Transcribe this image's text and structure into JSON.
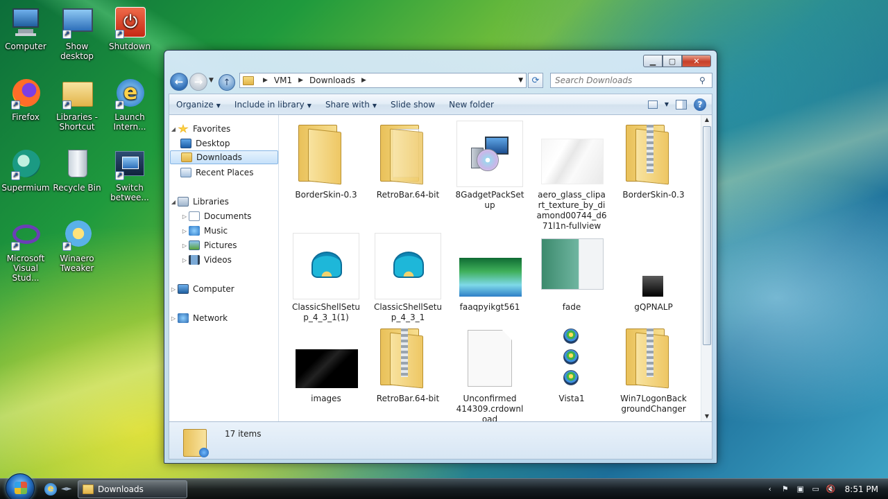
{
  "desktop": {
    "icons": [
      {
        "label": "Computer"
      },
      {
        "label": "Show desktop"
      },
      {
        "label": "Shutdown"
      },
      {
        "label": "Firefox"
      },
      {
        "label": "Libraries - Shortcut"
      },
      {
        "label": "Launch Intern..."
      },
      {
        "label": "Supermium"
      },
      {
        "label": "Recycle Bin"
      },
      {
        "label": "Switch betwee..."
      },
      {
        "label": "Microsoft Visual Stud..."
      },
      {
        "label": "Winaero Tweaker"
      }
    ]
  },
  "window": {
    "address": {
      "crumbs": [
        "VM1",
        "Downloads"
      ]
    },
    "search": {
      "placeholder": "Search Downloads"
    },
    "toolbar": {
      "organize": "Organize",
      "include": "Include in library",
      "share": "Share with",
      "slideshow": "Slide show",
      "newfolder": "New folder"
    },
    "nav": {
      "favorites": "Favorites",
      "desktop": "Desktop",
      "downloads": "Downloads",
      "recent": "Recent Places",
      "libraries": "Libraries",
      "documents": "Documents",
      "music": "Music",
      "pictures": "Pictures",
      "videos": "Videos",
      "computer": "Computer",
      "network": "Network"
    },
    "files": [
      {
        "name": "BorderSkin-0.3"
      },
      {
        "name": "RetroBar.64-bit"
      },
      {
        "name": "8GadgetPackSetup"
      },
      {
        "name": "aero_glass_clipart_texture_by_diamond00744_d671l1n-fullview"
      },
      {
        "name": "BorderSkin-0.3"
      },
      {
        "name": "ClassicShellSetup_4_3_1(1)"
      },
      {
        "name": "ClassicShellSetup_4_3_1"
      },
      {
        "name": "faaqpyikgt561"
      },
      {
        "name": "fade"
      },
      {
        "name": "gQPNALP"
      },
      {
        "name": "images"
      },
      {
        "name": "RetroBar.64-bit"
      },
      {
        "name": "Unconfirmed 414309.crdownload"
      },
      {
        "name": "Vista1"
      },
      {
        "name": "Win7LogonBackgroundChanger"
      }
    ],
    "details": {
      "count": "17 items"
    }
  },
  "taskbar": {
    "task": "Downloads",
    "clock": "8:51 PM"
  }
}
